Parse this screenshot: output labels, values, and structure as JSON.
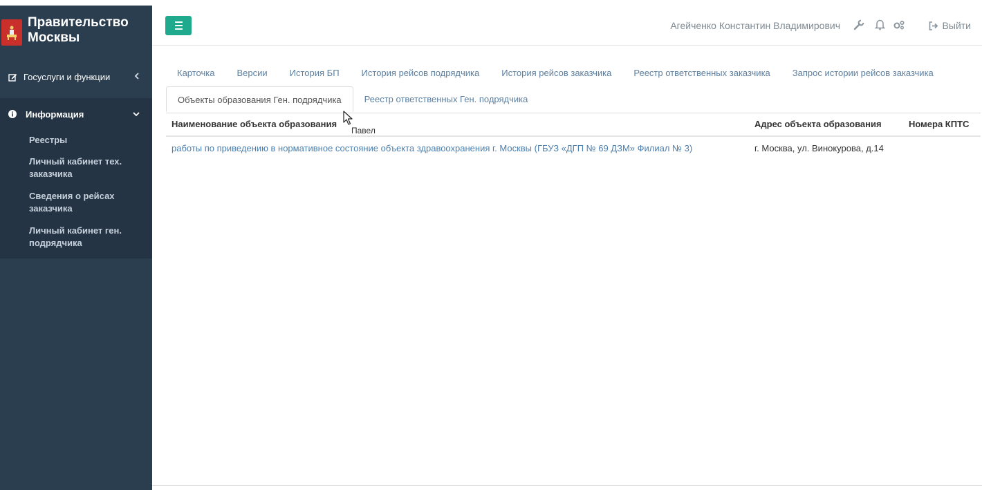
{
  "brand": {
    "title_line1": "Правительство",
    "title_line2": "Москвы"
  },
  "sidebar": {
    "gosuslugi": {
      "label": "Госуслуги и функции"
    },
    "info": {
      "label": "Информация"
    },
    "sub_items": [
      {
        "label": "Реестры"
      },
      {
        "label": "Личный кабинет тех. заказчика"
      },
      {
        "label": "Сведения о рейсах заказчика"
      },
      {
        "label": "Личный кабинет ген. подрядчика"
      }
    ]
  },
  "topbar": {
    "user_name": "Агейченко Константин Владимирович",
    "logout_label": "Выйти"
  },
  "tabs_row1": [
    {
      "label": "Карточка"
    },
    {
      "label": "Версии"
    },
    {
      "label": "История БП"
    },
    {
      "label": "История рейсов подрядчика"
    },
    {
      "label": "История рейсов заказчика"
    },
    {
      "label": "Реестр ответственных заказчика"
    },
    {
      "label": "Запрос истории рейсов заказчика"
    }
  ],
  "tabs_row2": [
    {
      "label": "Объекты образования Ген. подрядчика",
      "active": true
    },
    {
      "label": "Реестр ответственных Ген. подрядчика"
    }
  ],
  "table": {
    "columns": [
      "Наименование объекта образования",
      "Адрес объекта образования",
      "Номера КПТС"
    ],
    "rows": [
      {
        "name": "работы по приведению в нормативное состояние объекта здравоохранения г. Москвы (ГБУЗ «ДГП № 69 ДЗМ» Филиал № 3)",
        "address": "г. Москва, ул. Винокурова, д.14",
        "kpts": ""
      }
    ]
  },
  "tooltip": "Павел",
  "colors": {
    "sidebar_bg": "#2b3e50",
    "sidebar_active_bg": "#243444",
    "accent": "#1fa98d",
    "link": "#4a7fb0",
    "logo_red": "#c9302c"
  },
  "icons": [
    "edit-icon",
    "info-icon",
    "chevron-left-icon",
    "chevron-down-icon",
    "menu-icon",
    "wrench-icon",
    "bell-icon",
    "cogs-icon",
    "sign-out-icon",
    "mouse-cursor-icon"
  ]
}
